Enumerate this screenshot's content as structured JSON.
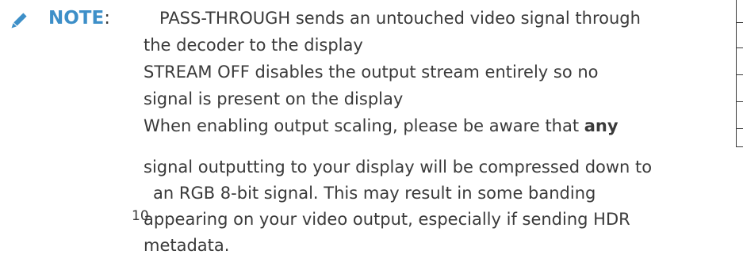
{
  "note": {
    "icon": "pencil-icon",
    "label": "NOTE",
    "colon": ":",
    "label_color": "#3d8fc8"
  },
  "lines": {
    "l1": "PASS-THROUGH sends an untouched video signal through",
    "l2": "the decoder to the display",
    "l3": "STREAM OFF disables the output stream entirely so no",
    "l4": "signal is present on the display",
    "l5_pre": "When enabling output scaling, please be aware that ",
    "l5_bold": "any",
    "l6": "signal outputting to your display will be compressed down to",
    "l7": "an RGB 8-bit signal. This may result in some banding",
    "l8": "appearing on your video output, especially if sending HDR",
    "l9": "metadata."
  },
  "page_number": "10"
}
